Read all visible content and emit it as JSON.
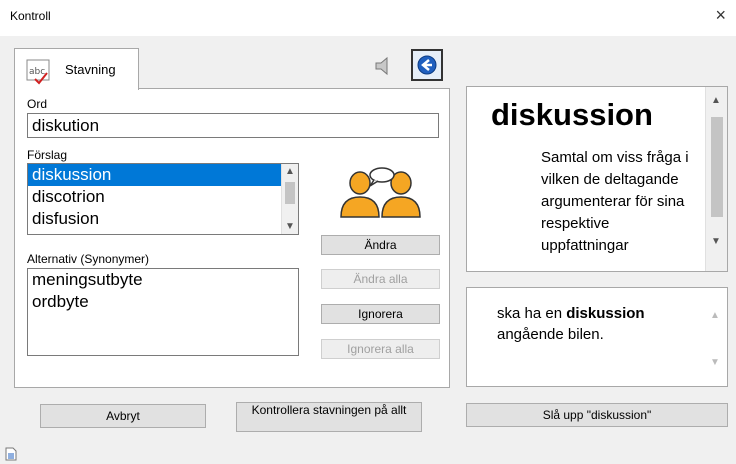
{
  "window": {
    "title": "Kontroll",
    "close_glyph": "×"
  },
  "tab": {
    "label": "Stavning",
    "icon": "abc-spellcheck-icon"
  },
  "tools": {
    "sound_icon": "speaker-icon",
    "back_icon": "back-arrow-icon"
  },
  "word": {
    "label": "Ord",
    "value": "diskution"
  },
  "suggestions": {
    "label": "Förslag",
    "items": [
      "diskussion",
      "discotrion",
      "disfusion"
    ],
    "selected_index": 0
  },
  "synonyms": {
    "label": "Alternativ (Synonymer)",
    "items": [
      "meningsutbyte",
      "ordbyte"
    ]
  },
  "actions": {
    "change": "Ändra",
    "change_all": "Ändra alla",
    "ignore": "Ignorera",
    "ignore_all": "Ignorera alla"
  },
  "dictionary": {
    "headword": "diskussion",
    "definition": "Samtal om viss fråga i vilken de deltagande argumenterar för sina respektive uppfattningar",
    "example_before": "ska ha en ",
    "example_bold": "diskussion",
    "example_after": " angående bilen."
  },
  "bottom": {
    "cancel": "Avbryt",
    "check_all": "Kontrollera stavningen på allt",
    "lookup": "Slå upp \"diskussion\""
  },
  "colors": {
    "selection": "#0078d7",
    "people": "#f5a623"
  }
}
